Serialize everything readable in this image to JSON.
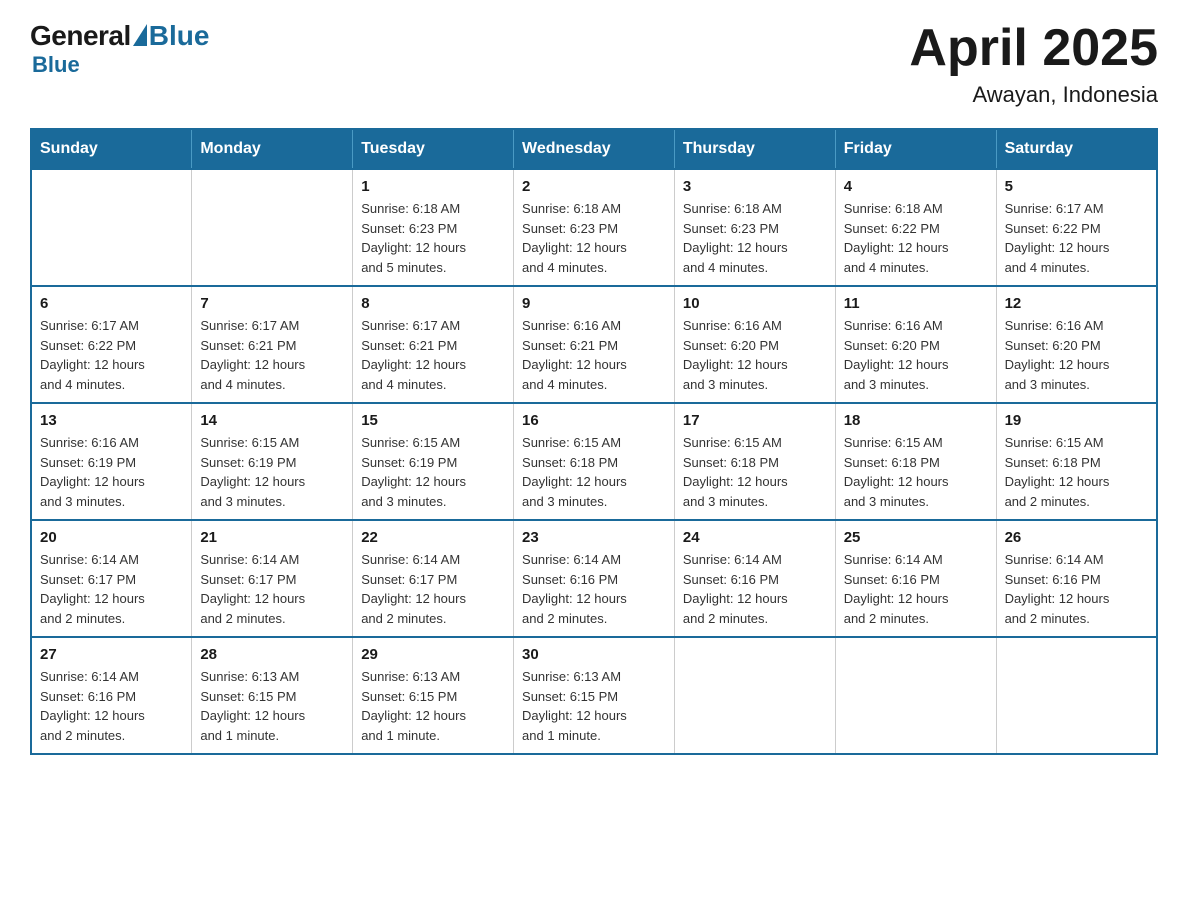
{
  "logo": {
    "general": "General",
    "blue": "Blue"
  },
  "title": {
    "month": "April 2025",
    "location": "Awayan, Indonesia"
  },
  "days_header": [
    "Sunday",
    "Monday",
    "Tuesday",
    "Wednesday",
    "Thursday",
    "Friday",
    "Saturday"
  ],
  "weeks": [
    [
      {
        "day": "",
        "info": ""
      },
      {
        "day": "",
        "info": ""
      },
      {
        "day": "1",
        "info": "Sunrise: 6:18 AM\nSunset: 6:23 PM\nDaylight: 12 hours\nand 5 minutes."
      },
      {
        "day": "2",
        "info": "Sunrise: 6:18 AM\nSunset: 6:23 PM\nDaylight: 12 hours\nand 4 minutes."
      },
      {
        "day": "3",
        "info": "Sunrise: 6:18 AM\nSunset: 6:23 PM\nDaylight: 12 hours\nand 4 minutes."
      },
      {
        "day": "4",
        "info": "Sunrise: 6:18 AM\nSunset: 6:22 PM\nDaylight: 12 hours\nand 4 minutes."
      },
      {
        "day": "5",
        "info": "Sunrise: 6:17 AM\nSunset: 6:22 PM\nDaylight: 12 hours\nand 4 minutes."
      }
    ],
    [
      {
        "day": "6",
        "info": "Sunrise: 6:17 AM\nSunset: 6:22 PM\nDaylight: 12 hours\nand 4 minutes."
      },
      {
        "day": "7",
        "info": "Sunrise: 6:17 AM\nSunset: 6:21 PM\nDaylight: 12 hours\nand 4 minutes."
      },
      {
        "day": "8",
        "info": "Sunrise: 6:17 AM\nSunset: 6:21 PM\nDaylight: 12 hours\nand 4 minutes."
      },
      {
        "day": "9",
        "info": "Sunrise: 6:16 AM\nSunset: 6:21 PM\nDaylight: 12 hours\nand 4 minutes."
      },
      {
        "day": "10",
        "info": "Sunrise: 6:16 AM\nSunset: 6:20 PM\nDaylight: 12 hours\nand 3 minutes."
      },
      {
        "day": "11",
        "info": "Sunrise: 6:16 AM\nSunset: 6:20 PM\nDaylight: 12 hours\nand 3 minutes."
      },
      {
        "day": "12",
        "info": "Sunrise: 6:16 AM\nSunset: 6:20 PM\nDaylight: 12 hours\nand 3 minutes."
      }
    ],
    [
      {
        "day": "13",
        "info": "Sunrise: 6:16 AM\nSunset: 6:19 PM\nDaylight: 12 hours\nand 3 minutes."
      },
      {
        "day": "14",
        "info": "Sunrise: 6:15 AM\nSunset: 6:19 PM\nDaylight: 12 hours\nand 3 minutes."
      },
      {
        "day": "15",
        "info": "Sunrise: 6:15 AM\nSunset: 6:19 PM\nDaylight: 12 hours\nand 3 minutes."
      },
      {
        "day": "16",
        "info": "Sunrise: 6:15 AM\nSunset: 6:18 PM\nDaylight: 12 hours\nand 3 minutes."
      },
      {
        "day": "17",
        "info": "Sunrise: 6:15 AM\nSunset: 6:18 PM\nDaylight: 12 hours\nand 3 minutes."
      },
      {
        "day": "18",
        "info": "Sunrise: 6:15 AM\nSunset: 6:18 PM\nDaylight: 12 hours\nand 3 minutes."
      },
      {
        "day": "19",
        "info": "Sunrise: 6:15 AM\nSunset: 6:18 PM\nDaylight: 12 hours\nand 2 minutes."
      }
    ],
    [
      {
        "day": "20",
        "info": "Sunrise: 6:14 AM\nSunset: 6:17 PM\nDaylight: 12 hours\nand 2 minutes."
      },
      {
        "day": "21",
        "info": "Sunrise: 6:14 AM\nSunset: 6:17 PM\nDaylight: 12 hours\nand 2 minutes."
      },
      {
        "day": "22",
        "info": "Sunrise: 6:14 AM\nSunset: 6:17 PM\nDaylight: 12 hours\nand 2 minutes."
      },
      {
        "day": "23",
        "info": "Sunrise: 6:14 AM\nSunset: 6:16 PM\nDaylight: 12 hours\nand 2 minutes."
      },
      {
        "day": "24",
        "info": "Sunrise: 6:14 AM\nSunset: 6:16 PM\nDaylight: 12 hours\nand 2 minutes."
      },
      {
        "day": "25",
        "info": "Sunrise: 6:14 AM\nSunset: 6:16 PM\nDaylight: 12 hours\nand 2 minutes."
      },
      {
        "day": "26",
        "info": "Sunrise: 6:14 AM\nSunset: 6:16 PM\nDaylight: 12 hours\nand 2 minutes."
      }
    ],
    [
      {
        "day": "27",
        "info": "Sunrise: 6:14 AM\nSunset: 6:16 PM\nDaylight: 12 hours\nand 2 minutes."
      },
      {
        "day": "28",
        "info": "Sunrise: 6:13 AM\nSunset: 6:15 PM\nDaylight: 12 hours\nand 1 minute."
      },
      {
        "day": "29",
        "info": "Sunrise: 6:13 AM\nSunset: 6:15 PM\nDaylight: 12 hours\nand 1 minute."
      },
      {
        "day": "30",
        "info": "Sunrise: 6:13 AM\nSunset: 6:15 PM\nDaylight: 12 hours\nand 1 minute."
      },
      {
        "day": "",
        "info": ""
      },
      {
        "day": "",
        "info": ""
      },
      {
        "day": "",
        "info": ""
      }
    ]
  ]
}
